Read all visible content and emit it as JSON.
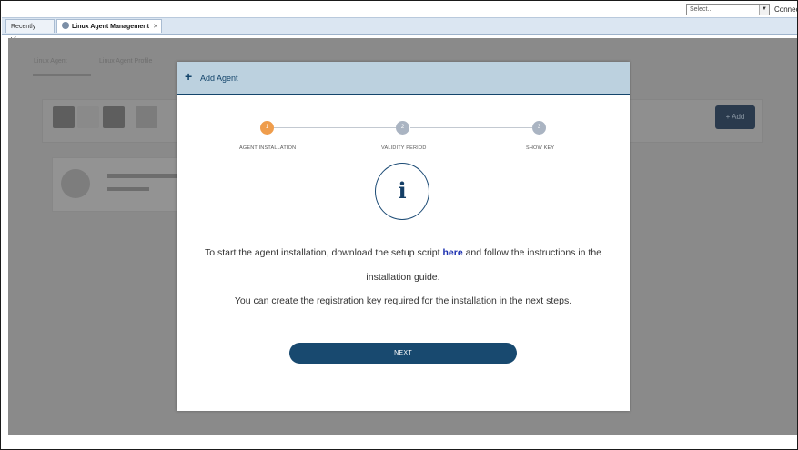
{
  "topbar": {
    "select_placeholder": "Select...",
    "connect_label": "Connect"
  },
  "tabs": [
    {
      "label": "Recently View"
    },
    {
      "label": "Linux Agent Management"
    }
  ],
  "background": {
    "subtab_1": "Linux Agent",
    "subtab_2": "Linux Agent Profile",
    "add_button": "+ Add"
  },
  "modal": {
    "title": "Add Agent",
    "steps": [
      {
        "number": "1",
        "label": "AGENT INSTALLATION",
        "state": "active"
      },
      {
        "number": "2",
        "label": "VALIDITY PERIOD",
        "state": "pending"
      },
      {
        "number": "3",
        "label": "SHOW KEY",
        "state": "pending"
      }
    ],
    "info_icon": "i",
    "message_part1": "To start the agent installation, download the setup script ",
    "message_link": "here",
    "message_part2": " and follow the instructions in the",
    "message_line2": "installation guide.",
    "message_line3": "You can create the registration key required for the installation in the next steps.",
    "next_label": "NEXT"
  },
  "colors": {
    "accent": "#18496f",
    "step_active": "#ef9d4c",
    "step_idle": "#aab4c2",
    "header_bg": "#bcd1df",
    "link": "#1b2fb0"
  }
}
